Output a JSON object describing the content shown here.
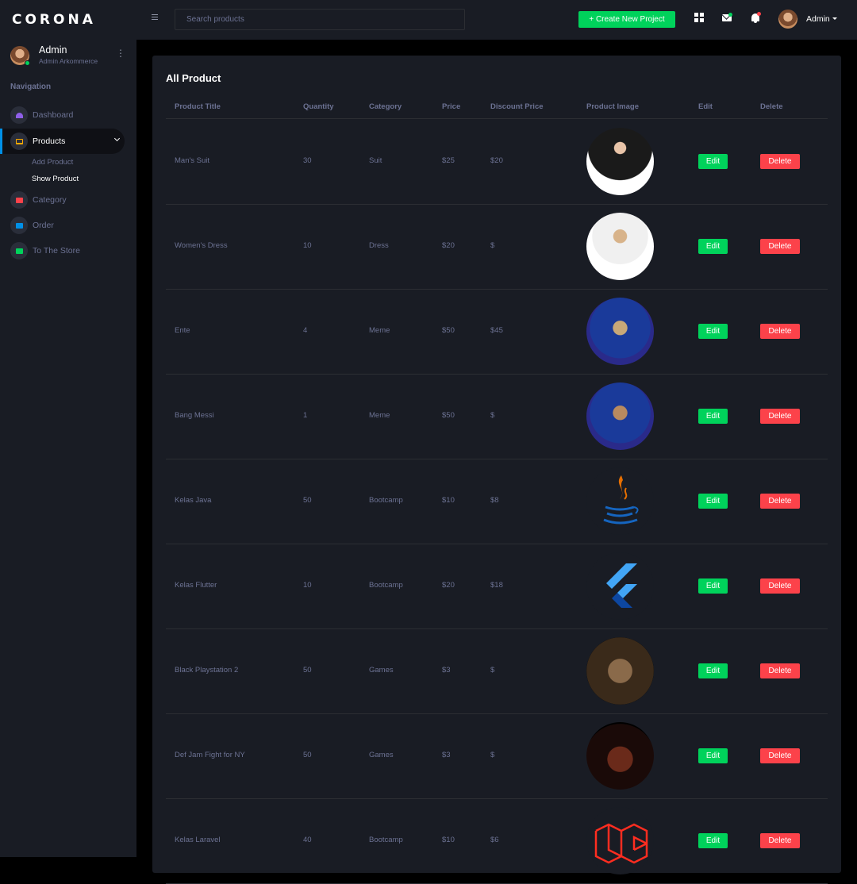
{
  "brand": "CORONA",
  "profile": {
    "name": "Admin",
    "subtitle": "Admin Arkommerce"
  },
  "nav": {
    "heading": "Navigation",
    "items": [
      {
        "label": "Dashboard",
        "icon": "speedometer-icon",
        "color": "#8f5fe8"
      },
      {
        "label": "Products",
        "icon": "laptop-icon",
        "color": "#ffab00"
      },
      {
        "label": "Category",
        "icon": "playlist-icon",
        "color": "#fc424a"
      },
      {
        "label": "Order",
        "icon": "chart-icon",
        "color": "#0090e7"
      },
      {
        "label": "To The Store",
        "icon": "contacts-icon",
        "color": "#00d25b"
      }
    ],
    "sub_items": [
      "Add Product",
      "Show Product"
    ]
  },
  "topbar": {
    "search_placeholder": "Search products",
    "create_label": "+ Create New Project",
    "user": "Admin"
  },
  "card": {
    "title": "All Product",
    "headers": [
      "Product Title",
      "Quantity",
      "Category",
      "Price",
      "Discount Price",
      "Product Image",
      "Edit",
      "Delete"
    ],
    "edit_label": "Edit",
    "delete_label": "Delete",
    "rows": [
      {
        "title": "Man's Suit",
        "quantity": "30",
        "category": "Suit",
        "price": "$25",
        "discount": "$20",
        "image": "suit-photo"
      },
      {
        "title": "Women's Dress",
        "quantity": "10",
        "category": "Dress",
        "price": "$20",
        "discount": "$",
        "image": "dress-photo"
      },
      {
        "title": "Ente",
        "quantity": "4",
        "category": "Meme",
        "price": "$50",
        "discount": "$45",
        "image": "fifa-card-ente"
      },
      {
        "title": "Bang Messi",
        "quantity": "1",
        "category": "Meme",
        "price": "$50",
        "discount": "$",
        "image": "fifa-card-messi"
      },
      {
        "title": "Kelas Java",
        "quantity": "50",
        "category": "Bootcamp",
        "price": "$10",
        "discount": "$8",
        "image": "java-logo"
      },
      {
        "title": "Kelas Flutter",
        "quantity": "10",
        "category": "Bootcamp",
        "price": "$20",
        "discount": "$18",
        "image": "flutter-logo"
      },
      {
        "title": "Black Playstation 2",
        "quantity": "50",
        "category": "Games",
        "price": "$3",
        "discount": "$",
        "image": "black-ps2-cover"
      },
      {
        "title": "Def Jam Fight for NY",
        "quantity": "50",
        "category": "Games",
        "price": "$3",
        "discount": "$",
        "image": "defjam-ps2-cover"
      },
      {
        "title": "Kelas Laravel",
        "quantity": "40",
        "category": "Bootcamp",
        "price": "$10",
        "discount": "$6",
        "image": "laravel-logo"
      }
    ]
  }
}
